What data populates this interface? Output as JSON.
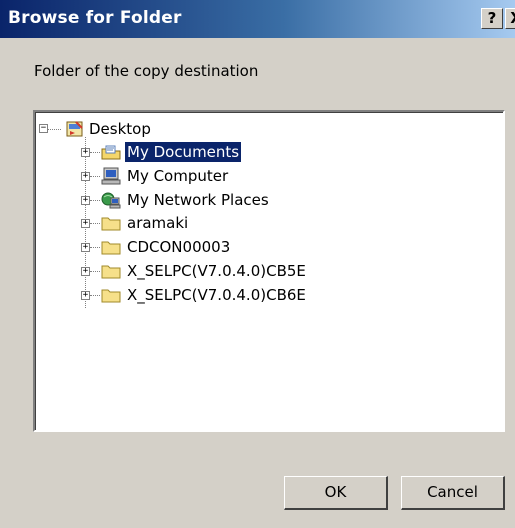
{
  "window": {
    "title": "Browse for Folder",
    "help_label": "?",
    "close_label": "X"
  },
  "prompt": "Folder of the copy destination",
  "tree": {
    "root": {
      "label": "Desktop",
      "icon": "desktop-icon",
      "expanded": true
    },
    "children": [
      {
        "label": "My Documents",
        "icon": "my-documents-icon",
        "selected": true
      },
      {
        "label": "My Computer",
        "icon": "my-computer-icon"
      },
      {
        "label": "My Network Places",
        "icon": "network-places-icon"
      },
      {
        "label": "aramaki",
        "icon": "folder-icon"
      },
      {
        "label": "CDCON00003",
        "icon": "folder-icon"
      },
      {
        "label": "X_SELPC(V7.0.4.0)CB5E",
        "icon": "folder-icon"
      },
      {
        "label": "X_SELPC(V7.0.4.0)CB6E",
        "icon": "folder-icon"
      }
    ]
  },
  "buttons": {
    "ok": "OK",
    "cancel": "Cancel"
  },
  "colors": {
    "titlebar_start": "#0a246a",
    "titlebar_end": "#a6caf0",
    "selection": "#0a246a",
    "face": "#d4d0c8"
  }
}
